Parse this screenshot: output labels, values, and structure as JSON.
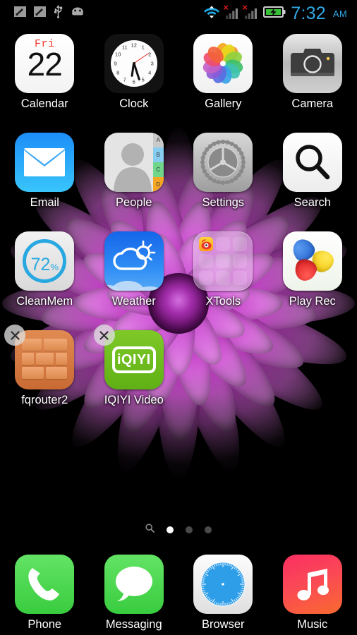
{
  "statusbar": {
    "left_icons": [
      {
        "name": "screenshot-icon"
      },
      {
        "name": "screenshot-icon"
      },
      {
        "name": "usb-icon"
      },
      {
        "name": "android-debug-icon"
      }
    ],
    "wifi_icon": "wifi-icon",
    "signal_icons": [
      {
        "name": "signal-bars-icon",
        "error": "×"
      },
      {
        "name": "signal-bars-icon",
        "error": "×"
      }
    ],
    "battery_icon": "battery-charging-icon",
    "time": "7:32",
    "ampm": "AM",
    "time_color": "#33a8e5"
  },
  "grid": {
    "rows": [
      [
        {
          "label": "Calendar",
          "icon": "calendar-icon",
          "day_of_week": "Fri",
          "day": "22",
          "removable": false
        },
        {
          "label": "Clock",
          "icon": "clock-icon",
          "removable": false
        },
        {
          "label": "Gallery",
          "icon": "gallery-icon",
          "removable": false
        },
        {
          "label": "Camera",
          "icon": "camera-icon",
          "removable": false
        }
      ],
      [
        {
          "label": "Email",
          "icon": "email-icon",
          "removable": false
        },
        {
          "label": "People",
          "icon": "people-icon",
          "tabs": [
            "A",
            "B",
            "C",
            "D"
          ],
          "removable": false
        },
        {
          "label": "Settings",
          "icon": "settings-icon",
          "removable": false
        },
        {
          "label": "Search",
          "icon": "search-icon",
          "removable": false
        }
      ],
      [
        {
          "label": "CleanMem",
          "icon": "cleanmem-icon",
          "value": "72",
          "unit": "%",
          "removable": false
        },
        {
          "label": "Weather",
          "icon": "weather-icon",
          "removable": false
        },
        {
          "label": "XTools",
          "icon": "folder-icon",
          "removable": false
        },
        {
          "label": "Play Rec",
          "icon": "play-rec-icon",
          "removable": false
        }
      ],
      [
        {
          "label": "fqrouter2",
          "icon": "fqrouter-icon",
          "removable": true,
          "remove_glyph": "×"
        },
        {
          "label": "IQIYI Video",
          "icon": "iqiyi-icon",
          "brand": "iQIYI",
          "removable": true,
          "remove_glyph": "×"
        }
      ]
    ]
  },
  "page_indicator": {
    "search_icon": "search-icon",
    "pages": 3,
    "active_page": 1
  },
  "dock": {
    "items": [
      {
        "label": "Phone",
        "icon": "phone-icon"
      },
      {
        "label": "Messaging",
        "icon": "message-bubble-icon"
      },
      {
        "label": "Browser",
        "icon": "compass-icon"
      },
      {
        "label": "Music",
        "icon": "music-note-icon"
      }
    ]
  },
  "wallpaper": {
    "name": "purple-dahlia-flower",
    "background_color": "#000000",
    "petal_color": "#b42bb6"
  }
}
